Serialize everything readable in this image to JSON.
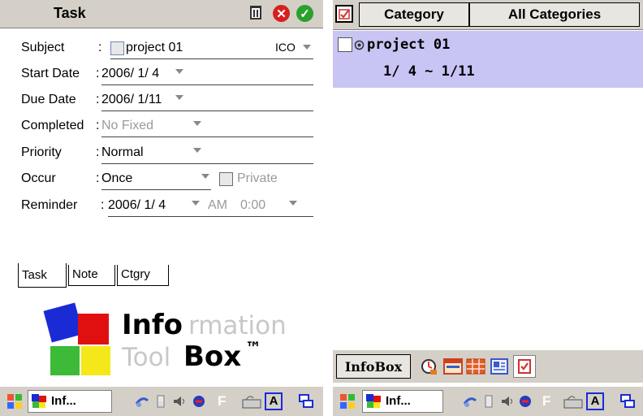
{
  "left_window": {
    "title": "Task",
    "fields": [
      {
        "label": "Subject",
        "value": "project 01",
        "extra": "ICO"
      },
      {
        "label": "Start Date",
        "value": "2006/ 1/ 4"
      },
      {
        "label": "Due Date",
        "value": "2006/ 1/11"
      },
      {
        "label": "Completed",
        "value": "No Fixed"
      },
      {
        "label": "Priority",
        "value": "Normal"
      },
      {
        "label": "Occur",
        "value": "Once",
        "checkbox_label": "Private"
      },
      {
        "label": "Reminder",
        "value": "2006/ 1/ 4",
        "ampm": "AM",
        "time": "0:00"
      }
    ],
    "tabs": [
      "Task",
      "Note",
      "Ctgry"
    ],
    "logo": {
      "line1": "Info",
      "line1_faded": "rmation",
      "line2_faded": "Tool",
      "line2": "Box",
      "tm": "™"
    },
    "taskbar": {
      "app_label": "Inf...",
      "letter_f": "F",
      "letter_a": "A"
    }
  },
  "right_window": {
    "header": {
      "category_label": "Category",
      "filter_value": "All Categories"
    },
    "task_item": {
      "title": "project 01",
      "date_range": "1/ 4 ~ 1/11"
    },
    "infobar": {
      "label": "InfoBox"
    },
    "taskbar": {
      "app_label": "Inf...",
      "letter_f": "F",
      "letter_a": "A"
    }
  },
  "colors": {
    "selection": "#c8c4f4",
    "delete_red": "#d62020",
    "ok_green": "#2ca02c",
    "chrome": "#d4d0c8"
  }
}
